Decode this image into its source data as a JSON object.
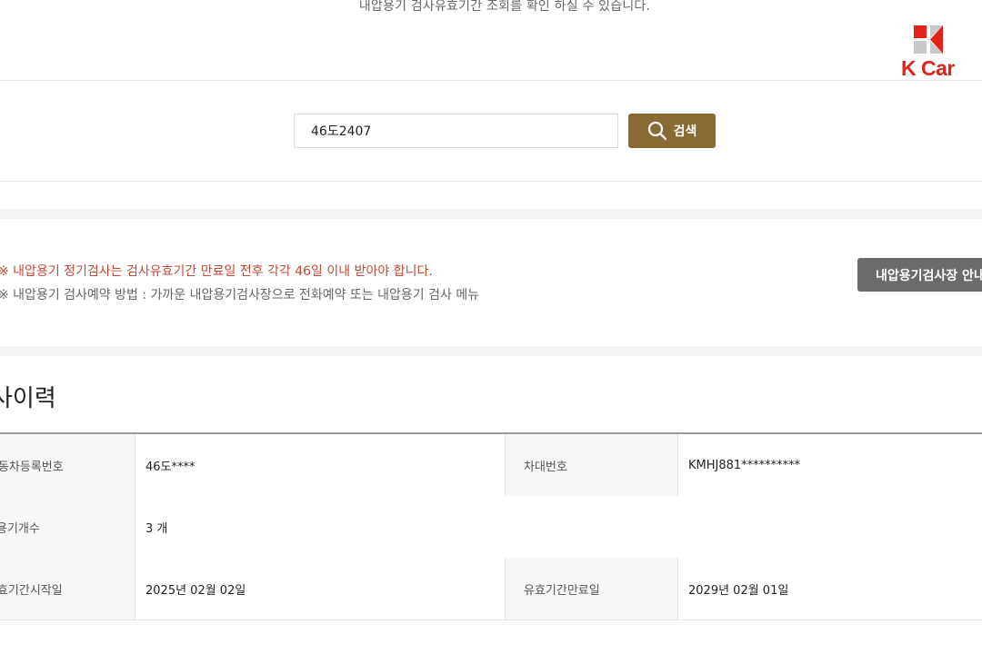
{
  "header": {
    "description": "내압용기 검사유효기간 조회를 확인 하실 수 있습니다.",
    "logo_text": "K Car"
  },
  "search": {
    "value": "46도2407",
    "button_label": "검색"
  },
  "notices": {
    "line1": "※ 내압용기 정기검사는 검사유효기간 만료일 전후 각각 46일 이내 받아야 합니다.",
    "line2": "※ 내압용기 검사예약 방법 : 가까운 내압용기검사장으로 전화예약 또는 내압용기 검사 메뉴",
    "guide_button": "내압용기검사장 안내"
  },
  "section": {
    "title": "사이력"
  },
  "table": {
    "rows": [
      {
        "label1": "자동차등록번호",
        "value1": "46도****",
        "label2": "차대번호",
        "value2": "KMHJ881**********"
      },
      {
        "label1": "용기개수",
        "value1": "3 개"
      },
      {
        "label1": "유효기간시작일",
        "value1": "2025년 02월 02일",
        "label2": "유효기간만료일",
        "value2": "2029년 02월 01일"
      }
    ]
  },
  "colors": {
    "brand": "#e2231a",
    "search_button": "#8a6a33",
    "notice_red": "#c24a35",
    "guide_button": "#6b6b6b"
  }
}
